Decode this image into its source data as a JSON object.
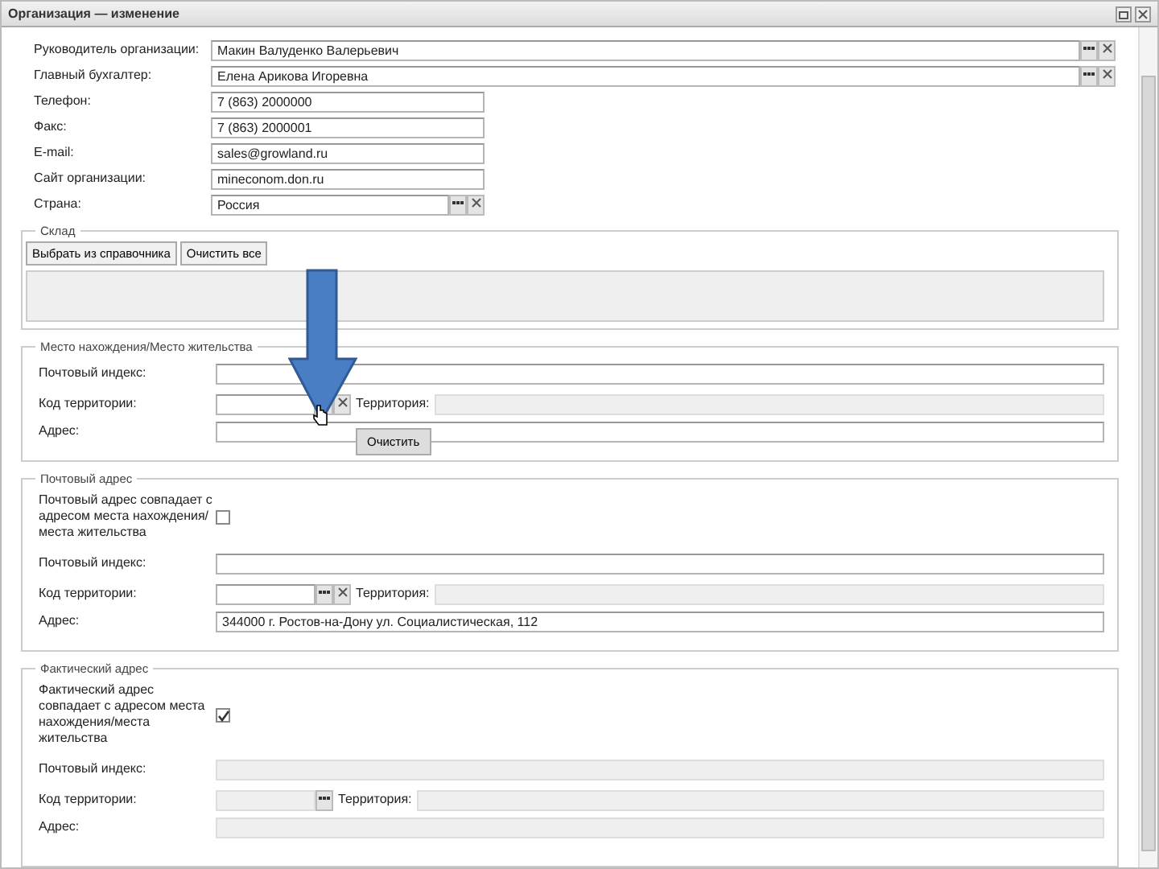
{
  "window": {
    "title": "Организация — изменение"
  },
  "fields": [
    {
      "label": "Руководитель организации:",
      "value": "Макин Валуденко Валерьевич",
      "kind": "picker"
    },
    {
      "label": "Главный бухгалтер:",
      "value": "Елена Арикова Игоревна",
      "kind": "picker"
    },
    {
      "label": "Телефон:",
      "value": "7 (863) 2000000",
      "kind": "text"
    },
    {
      "label": "Факс:",
      "value": "7 (863) 2000001",
      "kind": "text"
    },
    {
      "label": "E-mail:",
      "value": "sales@growland.ru",
      "kind": "text"
    },
    {
      "label": "Сайт организации:",
      "value": "mineconom.don.ru",
      "kind": "text"
    },
    {
      "label": "Страна:",
      "value": "Россия",
      "kind": "select"
    }
  ],
  "warehouse": {
    "legend": "Склад",
    "buttons": [
      "Выбрать из справочника",
      "Очистить все"
    ]
  },
  "addresses": [
    {
      "legend": "Место нахождения/Место жительства",
      "disabled": false,
      "postal_label": "Почтовый индекс:",
      "code_label": "Код территории:",
      "territory_label": "Территория:",
      "address_label": "Адрес:"
    },
    {
      "legend": "Почтовый адрес",
      "disabled": false,
      "same_as": {
        "label": "Почтовый адрес совпадает с адресом места нахождения/места жительства",
        "checked": false
      },
      "postal_label": "Почтовый индекс:",
      "code_label": "Код территории:",
      "territory_label": "Территория:",
      "address_label": "Адрес:",
      "address_value": "344000 г. Ростов-на-Дону ул. Социалистическая, 112"
    },
    {
      "legend": "Фактический адрес",
      "disabled": true,
      "same_as": {
        "label": "Фактический адрес совпадает с адресом места нахождения/места жительства",
        "checked": true
      },
      "postal_label": "Почтовый индекс:",
      "code_label": "Код территории:",
      "territory_label": "Территория:",
      "address_label": "Адрес:"
    }
  ],
  "clear_button": "Очистить",
  "annotation": {
    "kind": "arrow"
  }
}
